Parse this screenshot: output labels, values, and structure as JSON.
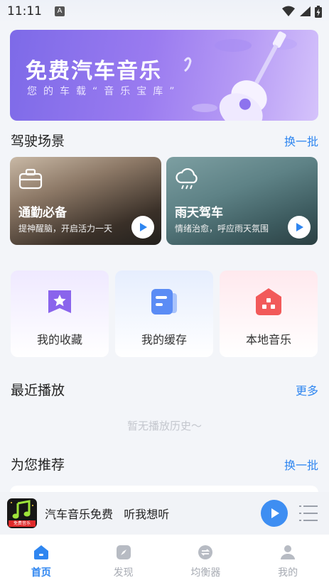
{
  "status_bar": {
    "time": "11:11",
    "notif_letter": "A"
  },
  "banner": {
    "title": "免费汽车音乐",
    "subtitle": "您的车载“音乐宝库”"
  },
  "driving": {
    "title": "驾驶场景",
    "refresh": "换一批",
    "cards": [
      {
        "title": "通勤必备",
        "subtitle": "提神醒脑，开启活力一天"
      },
      {
        "title": "雨天驾车",
        "subtitle": "情绪治愈，呼应雨天氛围"
      }
    ]
  },
  "tiles": [
    {
      "label": "我的收藏",
      "icon": "star-folder-icon"
    },
    {
      "label": "我的缓存",
      "icon": "cache-doc-icon"
    },
    {
      "label": "本地音乐",
      "icon": "local-house-icon"
    }
  ],
  "recent": {
    "title": "最近播放",
    "more": "更多",
    "empty": "暂无播放历史～"
  },
  "recommend": {
    "title": "为您推荐",
    "refresh": "换一批"
  },
  "player": {
    "text": "汽车音乐免费   听我想听",
    "cover_label": "免费音乐"
  },
  "tabs": [
    {
      "label": "首页",
      "icon": "home-icon",
      "active": true
    },
    {
      "label": "发现",
      "icon": "compass-icon",
      "active": false
    },
    {
      "label": "均衡器",
      "icon": "equalizer-icon",
      "active": false
    },
    {
      "label": "我的",
      "icon": "user-icon",
      "active": false
    }
  ],
  "colors": {
    "accent": "#2f86f0",
    "player_button": "#3e8ef2",
    "banner": "#8d73ee"
  }
}
